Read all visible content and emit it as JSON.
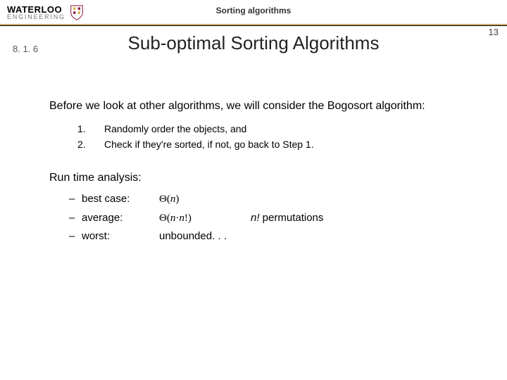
{
  "header": {
    "logo_top": "WATERLOO",
    "logo_bottom": "ENGINEERING",
    "running_head": "Sorting algorithms",
    "page_number": "13"
  },
  "section_number": "8. 1. 6",
  "title": "Sub-optimal Sorting Algorithms",
  "intro": "Before we look at other algorithms, we will consider the Bogosort algorithm:",
  "steps": [
    {
      "n": "1.",
      "text": "Randomly order the objects, and"
    },
    {
      "n": "2.",
      "text": "Check if they're sorted, if not, go back to Step 1."
    }
  ],
  "runtime_heading": "Run time analysis:",
  "cases": {
    "best": {
      "label": "best case:",
      "value": "Θ(n)",
      "note": ""
    },
    "avg": {
      "label": "average:",
      "value": "Θ(n·n!)",
      "note_prefix": "n!",
      "note_rest": " permutations"
    },
    "worst": {
      "label": "worst:",
      "value": "unbounded. . .",
      "note": ""
    }
  }
}
